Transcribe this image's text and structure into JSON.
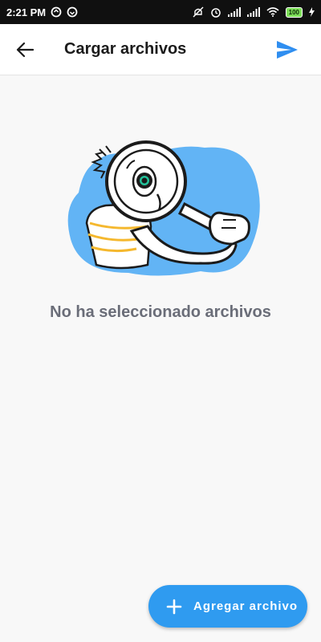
{
  "status_bar": {
    "time": "2:21 PM",
    "battery": "100"
  },
  "app_bar": {
    "title": "Cargar archivos",
    "back_icon": "arrow-left-icon",
    "send_icon": "send-icon"
  },
  "empty_state": {
    "message": "No ha seleccionado archivos",
    "illustration": "magnifying-glass-person"
  },
  "fab": {
    "label": "Agregar archivo",
    "icon": "plus-icon"
  },
  "colors": {
    "accent": "#2f9bf0",
    "blob": "#62b4f5",
    "text_muted": "#6a6d78"
  }
}
